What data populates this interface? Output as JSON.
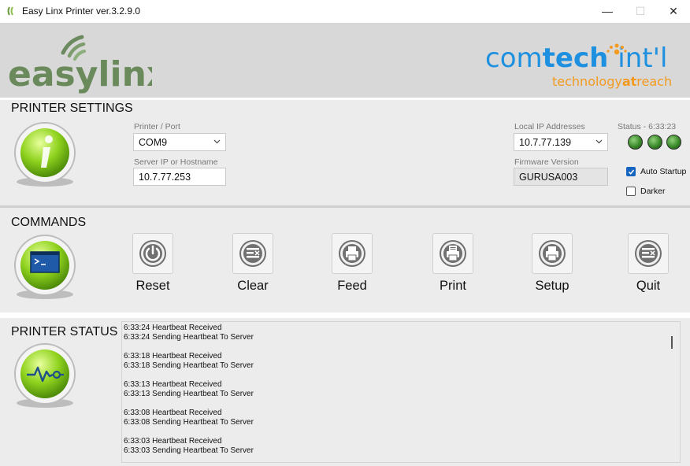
{
  "window": {
    "title": "Easy Linx Printer ver.3.2.9.0",
    "controls": {
      "minimize": "—",
      "maximize": "☐",
      "close": "✕"
    }
  },
  "branding": {
    "left_logo": "easylinx",
    "right_logo_main_a": "com",
    "right_logo_main_b": "tech",
    "right_logo_main_c": "int'l",
    "right_logo_tag_a": "technology",
    "right_logo_tag_b": "at",
    "right_logo_tag_c": "reach",
    "colors": {
      "green": "#6a8a5c",
      "blue": "#1e90e0",
      "orange": "#f39a1e"
    }
  },
  "printer_settings": {
    "title": "PRINTER SETTINGS",
    "icon": "info-icon",
    "printer_port_label": "Printer / Port",
    "printer_port_value": "COM9",
    "server_label": "Server IP or Hostname",
    "server_value": "10.7.77.253",
    "local_ip_label": "Local IP Addresses",
    "local_ip_value": "10.7.77.139",
    "firmware_label": "Firmware Version",
    "firmware_value": "GURUSA003",
    "status_label": "Status - 6:33:23",
    "status_leds": [
      "#3a8a2a",
      "#3a8a2a",
      "#3a8a2a"
    ],
    "auto_startup_label": "Auto Startup",
    "auto_startup_checked": true,
    "darker_label": "Darker",
    "darker_checked": false
  },
  "commands": {
    "title": "COMMANDS",
    "icon": "terminal-icon",
    "buttons": [
      {
        "label": "Reset",
        "icon": "power-icon"
      },
      {
        "label": "Clear",
        "icon": "list-clear-icon"
      },
      {
        "label": "Feed",
        "icon": "printer-icon"
      },
      {
        "label": "Print",
        "icon": "print-document-icon"
      },
      {
        "label": "Setup",
        "icon": "printer-setup-icon"
      },
      {
        "label": "Quit",
        "icon": "list-quit-icon"
      }
    ]
  },
  "printer_status": {
    "title": "PRINTER STATUS",
    "icon": "heartbeat-icon",
    "log": [
      [
        "6:33:24 Heartbeat Received",
        "6:33:24 Sending Heartbeat To Server"
      ],
      [
        "6:33:18 Heartbeat Received",
        "6:33:18 Sending Heartbeat To Server"
      ],
      [
        "6:33:13 Heartbeat Received",
        "6:33:13 Sending Heartbeat To Server"
      ],
      [
        "6:33:08 Heartbeat Received",
        "6:33:08 Sending Heartbeat To Server"
      ],
      [
        "6:33:03 Heartbeat Received",
        "6:33:03 Sending Heartbeat To Server"
      ]
    ]
  }
}
